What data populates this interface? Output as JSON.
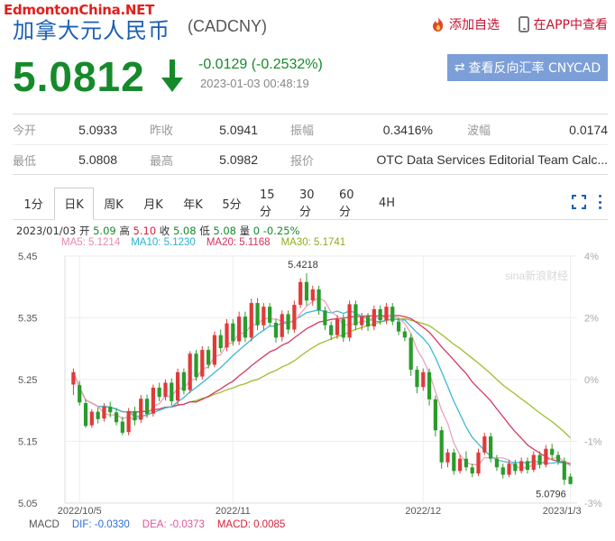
{
  "watermark": "EdmontonChina.NET",
  "header": {
    "title": "加拿大元人民币",
    "code": "(CADCNY)",
    "favorite_label": "添加自选",
    "app_label": "在APP中查看"
  },
  "quote": {
    "price": "5.0812",
    "change": "-0.0129 (-0.2532%)",
    "time": "2023-01-03 00:48:19",
    "reverse_button": "查看反向汇率 CNYCAD",
    "rows": [
      [
        {
          "label": "今开",
          "value": "5.0933"
        },
        {
          "label": "昨收",
          "value": "5.0941"
        },
        {
          "label": "振幅",
          "value": "0.3416%"
        },
        {
          "label": "波幅",
          "value": "0.0174"
        }
      ],
      [
        {
          "label": "最低",
          "value": "5.0808"
        },
        {
          "label": "最高",
          "value": "5.0982"
        },
        {
          "label": "报价",
          "value": "OTC Data Services Editorial Team Calc..."
        }
      ]
    ]
  },
  "chart": {
    "tabs": [
      "1分",
      "日K",
      "周K",
      "月K",
      "年K",
      "5分",
      "15分",
      "30分",
      "60分",
      "4H"
    ],
    "active_tab": "日K",
    "info": {
      "date": "2023/01/03",
      "open_label": "开",
      "open": "5.09",
      "high_label": "高",
      "high": "5.10",
      "close_label": "收",
      "close": "5.08",
      "low_label": "低",
      "low": "5.08",
      "volume_label": "量",
      "volume": "0",
      "pct": "-0.25%"
    },
    "ma": {
      "ma5": "MA5: 5.1214",
      "ma10": "MA10: 5.1230",
      "ma20": "MA20: 5.1168",
      "ma30": "MA30: 5.1741"
    },
    "macd": {
      "label": "MACD",
      "dif": "DIF: -0.0330",
      "dea": "DEA: -0.0373",
      "macd": "MACD: 0.0085"
    },
    "colors": {
      "up": "#e03a3a",
      "down": "#2a9c2a",
      "ma5": "#f0a0b8",
      "ma10": "#3cb8d6",
      "ma20": "#d63a60",
      "ma30": "#9cbe2a"
    }
  },
  "chart_data": {
    "type": "candlestick",
    "y_ticks": [
      "5.45",
      "5.35",
      "5.25",
      "5.15",
      "5.05"
    ],
    "y_right_ticks": [
      "4%",
      "2%",
      "0%",
      "-1%",
      "-3%"
    ],
    "x_labels": [
      "2022/10/5",
      "2022/11",
      "2022/12",
      "2023/1/3"
    ],
    "ylim": [
      5.05,
      5.45
    ],
    "max_label": "5.4218",
    "min_label": "5.0796",
    "source_mark": "sina新浪财经",
    "candles": [
      [
        5.242,
        5.262,
        5.225,
        5.268
      ],
      [
        5.241,
        5.213,
        5.208,
        5.248
      ],
      [
        5.212,
        5.175,
        5.172,
        5.218
      ],
      [
        5.176,
        5.198,
        5.172,
        5.202
      ],
      [
        5.198,
        5.186,
        5.179,
        5.205
      ],
      [
        5.187,
        5.206,
        5.182,
        5.212
      ],
      [
        5.206,
        5.197,
        5.189,
        5.214
      ],
      [
        5.197,
        5.181,
        5.176,
        5.204
      ],
      [
        5.182,
        5.164,
        5.16,
        5.19
      ],
      [
        5.165,
        5.199,
        5.16,
        5.204
      ],
      [
        5.199,
        5.184,
        5.176,
        5.206
      ],
      [
        5.185,
        5.219,
        5.18,
        5.225
      ],
      [
        5.219,
        5.194,
        5.188,
        5.226
      ],
      [
        5.195,
        5.237,
        5.19,
        5.242
      ],
      [
        5.237,
        5.222,
        5.215,
        5.245
      ],
      [
        5.222,
        5.245,
        5.216,
        5.25
      ],
      [
        5.245,
        5.215,
        5.208,
        5.252
      ],
      [
        5.216,
        5.262,
        5.21,
        5.268
      ],
      [
        5.262,
        5.232,
        5.226,
        5.268
      ],
      [
        5.233,
        5.292,
        5.228,
        5.296
      ],
      [
        5.292,
        5.254,
        5.248,
        5.298
      ],
      [
        5.255,
        5.298,
        5.25,
        5.304
      ],
      [
        5.298,
        5.274,
        5.268,
        5.304
      ],
      [
        5.274,
        5.322,
        5.27,
        5.328
      ],
      [
        5.322,
        5.301,
        5.294,
        5.331
      ],
      [
        5.302,
        5.341,
        5.296,
        5.348
      ],
      [
        5.341,
        5.312,
        5.305,
        5.348
      ],
      [
        5.312,
        5.352,
        5.306,
        5.36
      ],
      [
        5.352,
        5.318,
        5.311,
        5.36
      ],
      [
        5.318,
        5.374,
        5.312,
        5.381
      ],
      [
        5.374,
        5.338,
        5.33,
        5.382
      ],
      [
        5.338,
        5.368,
        5.33,
        5.374
      ],
      [
        5.368,
        5.342,
        5.336,
        5.374
      ],
      [
        5.342,
        5.318,
        5.31,
        5.348
      ],
      [
        5.319,
        5.356,
        5.312,
        5.362
      ],
      [
        5.356,
        5.331,
        5.324,
        5.362
      ],
      [
        5.331,
        5.371,
        5.326,
        5.378
      ],
      [
        5.371,
        5.408,
        5.366,
        5.414
      ],
      [
        5.408,
        5.378,
        5.37,
        5.422
      ],
      [
        5.378,
        5.396,
        5.37,
        5.402
      ],
      [
        5.396,
        5.362,
        5.355,
        5.402
      ],
      [
        5.362,
        5.338,
        5.33,
        5.368
      ],
      [
        5.338,
        5.322,
        5.314,
        5.344
      ],
      [
        5.322,
        5.348,
        5.316,
        5.354
      ],
      [
        5.348,
        5.318,
        5.311,
        5.356
      ],
      [
        5.318,
        5.372,
        5.312,
        5.378
      ],
      [
        5.372,
        5.338,
        5.33,
        5.378
      ],
      [
        5.338,
        5.352,
        5.33,
        5.358
      ],
      [
        5.352,
        5.336,
        5.329,
        5.358
      ],
      [
        5.336,
        5.364,
        5.33,
        5.37
      ],
      [
        5.364,
        5.346,
        5.339,
        5.37
      ],
      [
        5.346,
        5.368,
        5.34,
        5.374
      ],
      [
        5.368,
        5.344,
        5.338,
        5.374
      ],
      [
        5.344,
        5.328,
        5.322,
        5.35
      ],
      [
        5.328,
        5.318,
        5.312,
        5.334
      ],
      [
        5.318,
        5.266,
        5.256,
        5.324
      ],
      [
        5.266,
        5.238,
        5.228,
        5.272
      ],
      [
        5.238,
        5.262,
        5.232,
        5.268
      ],
      [
        5.262,
        5.218,
        5.208,
        5.268
      ],
      [
        5.218,
        5.168,
        5.158,
        5.224
      ],
      [
        5.168,
        5.116,
        5.106,
        5.174
      ],
      [
        5.116,
        5.132,
        5.108,
        5.138
      ],
      [
        5.132,
        5.102,
        5.096,
        5.138
      ],
      [
        5.102,
        5.122,
        5.098,
        5.128
      ],
      [
        5.122,
        5.108,
        5.102,
        5.134
      ],
      [
        5.108,
        5.098,
        5.092,
        5.114
      ],
      [
        5.098,
        5.132,
        5.094,
        5.138
      ],
      [
        5.132,
        5.158,
        5.128,
        5.164
      ],
      [
        5.158,
        5.122,
        5.116,
        5.164
      ],
      [
        5.122,
        5.108,
        5.102,
        5.128
      ],
      [
        5.108,
        5.096,
        5.09,
        5.114
      ],
      [
        5.096,
        5.114,
        5.092,
        5.12
      ],
      [
        5.114,
        5.102,
        5.096,
        5.12
      ],
      [
        5.102,
        5.118,
        5.098,
        5.124
      ],
      [
        5.118,
        5.104,
        5.098,
        5.124
      ],
      [
        5.104,
        5.128,
        5.1,
        5.134
      ],
      [
        5.128,
        5.112,
        5.106,
        5.134
      ],
      [
        5.112,
        5.138,
        5.108,
        5.144
      ],
      [
        5.138,
        5.128,
        5.12,
        5.146
      ],
      [
        5.128,
        5.118,
        5.112,
        5.134
      ],
      [
        5.118,
        5.088,
        5.0796,
        5.124
      ],
      [
        5.093,
        5.081,
        5.08,
        5.098
      ]
    ]
  }
}
